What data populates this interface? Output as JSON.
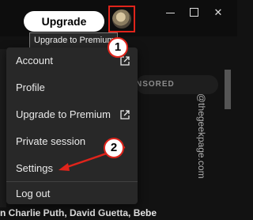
{
  "topbar": {
    "upgrade_label": "Upgrade",
    "tooltip": "Upgrade to Premium",
    "window_controls": [
      "minimize-icon",
      "maximize-icon",
      "close-icon"
    ]
  },
  "menu": {
    "items": [
      {
        "label": "Account",
        "external": true
      },
      {
        "label": "Profile",
        "external": false
      },
      {
        "label": "Upgrade to Premium",
        "external": true
      },
      {
        "label": "Private session",
        "external": false
      },
      {
        "label": "Settings",
        "external": false
      },
      {
        "label": "Log out",
        "external": false
      }
    ]
  },
  "background": {
    "sponsored_label": "NSORED",
    "bottom_text": "n Charlie Puth, David Guetta, Bebe",
    "watermark": "@thegeekpage.com"
  },
  "annotations": {
    "badge1": "1",
    "badge2": "2"
  },
  "colors": {
    "background": "#121212",
    "menu_bg": "#282828",
    "annotation_red": "#e0241b"
  }
}
